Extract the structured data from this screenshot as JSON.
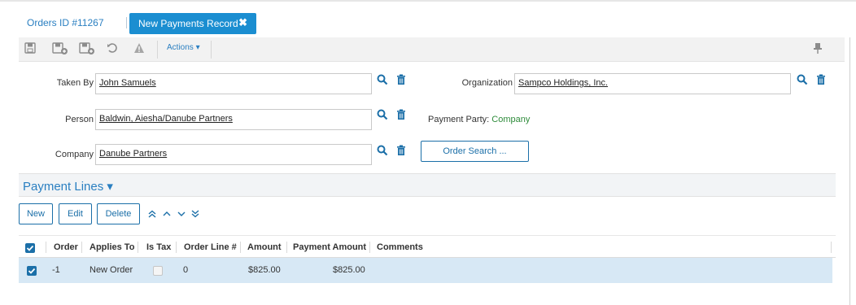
{
  "tabs": {
    "link_label": "Orders ID #11267",
    "active_label": "New Payments Record",
    "close_glyph": "✖"
  },
  "toolbar": {
    "icons": [
      "save-icon",
      "save-add-icon",
      "save-new-icon",
      "undo-icon",
      "warning-icon"
    ],
    "actions_label": "Actions ▾",
    "pin_icon": "pin-icon"
  },
  "form": {
    "taken_by": {
      "label": "Taken By",
      "value": "John Samuels"
    },
    "person": {
      "label": "Person",
      "value": "Baldwin, Aiesha/Danube Partners"
    },
    "company": {
      "label": "Company",
      "value": "Danube Partners"
    },
    "organization": {
      "label": "Organization",
      "value": "Sampco Holdings, Inc."
    },
    "payment_party": {
      "label": "Payment Party:",
      "value": "Company"
    },
    "order_search_label": "Order Search ..."
  },
  "payment_lines": {
    "title": "Payment Lines ▾",
    "buttons": {
      "new": "New",
      "edit": "Edit",
      "delete": "Delete"
    },
    "columns": [
      "Order",
      "Applies To",
      "Is Tax",
      "Order Line #",
      "Amount",
      "Payment Amount",
      "Comments"
    ],
    "rows": [
      {
        "order": "-1",
        "applies_to": "New Order",
        "is_tax": false,
        "order_line": "0",
        "amount": "$825.00",
        "payment_amount": "$825.00",
        "comments": ""
      }
    ]
  },
  "colors": {
    "accent": "#1b8ed1",
    "link": "#2a7fc1",
    "selected_row": "#d7e8f5",
    "party_value": "#2e8b3a"
  }
}
